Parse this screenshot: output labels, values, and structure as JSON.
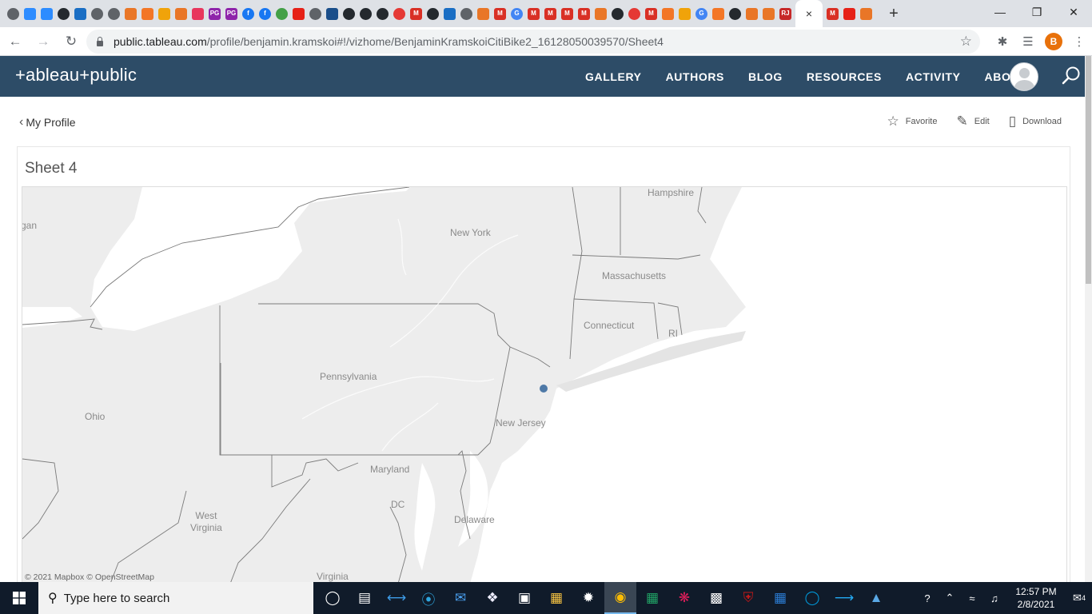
{
  "browser": {
    "tab_close_glyph": "×",
    "new_tab_glyph": "+",
    "tab_favicons": [
      {
        "name": "globe-icon",
        "color": "#5f6368",
        "glyph": "",
        "round": true
      },
      {
        "name": "zoom-icon",
        "color": "#2d8cff",
        "glyph": "",
        "round": false
      },
      {
        "name": "zoom-icon",
        "color": "#2d8cff",
        "glyph": "",
        "round": false
      },
      {
        "name": "github-icon",
        "color": "#24292e",
        "glyph": "",
        "round": true
      },
      {
        "name": "citibike-icon",
        "color": "#1a6ec4",
        "glyph": "",
        "round": false
      },
      {
        "name": "globe-icon",
        "color": "#5f6368",
        "glyph": "",
        "round": true
      },
      {
        "name": "globe-icon",
        "color": "#5f6368",
        "glyph": "",
        "round": true
      },
      {
        "name": "tableau-icon",
        "color": "#e97627",
        "glyph": "",
        "round": false
      },
      {
        "name": "jupyter-icon",
        "color": "#f37626",
        "glyph": "",
        "round": false
      },
      {
        "name": "notebook-icon",
        "color": "#f0a30a",
        "glyph": "",
        "round": false
      },
      {
        "name": "tableau-icon",
        "color": "#e97627",
        "glyph": "",
        "round": false
      },
      {
        "name": "stack-icon",
        "color": "#e8365d",
        "glyph": "",
        "round": false
      },
      {
        "name": "pg-icon",
        "color": "#8e24aa",
        "glyph": "PG",
        "round": false
      },
      {
        "name": "pg-icon",
        "color": "#8e24aa",
        "glyph": "PG",
        "round": false
      },
      {
        "name": "facebook-icon",
        "color": "#1877f2",
        "glyph": "f",
        "round": true
      },
      {
        "name": "facebook-icon",
        "color": "#1877f2",
        "glyph": "f",
        "round": true
      },
      {
        "name": "spiral-icon",
        "color": "#43a047",
        "glyph": "",
        "round": true
      },
      {
        "name": "youtube-icon",
        "color": "#e62117",
        "glyph": "",
        "round": false
      },
      {
        "name": "globe-icon",
        "color": "#5f6368",
        "glyph": "",
        "round": true
      },
      {
        "name": "atp-icon",
        "color": "#1a4e8a",
        "glyph": "",
        "round": false
      },
      {
        "name": "github-icon",
        "color": "#24292e",
        "glyph": "",
        "round": true
      },
      {
        "name": "github-icon",
        "color": "#24292e",
        "glyph": "",
        "round": true
      },
      {
        "name": "github-icon",
        "color": "#24292e",
        "glyph": "",
        "round": true
      },
      {
        "name": "lifebuoy-icon",
        "color": "#e53935",
        "glyph": "",
        "round": true
      },
      {
        "name": "gmail-icon",
        "color": "#d93025",
        "glyph": "M",
        "round": false
      },
      {
        "name": "github-icon",
        "color": "#24292e",
        "glyph": "",
        "round": true
      },
      {
        "name": "citibike-icon",
        "color": "#1a6ec4",
        "glyph": "",
        "round": false
      },
      {
        "name": "globe-icon",
        "color": "#5f6368",
        "glyph": "",
        "round": true
      },
      {
        "name": "tableau-icon",
        "color": "#e97627",
        "glyph": "",
        "round": false
      },
      {
        "name": "gmail-icon",
        "color": "#d93025",
        "glyph": "M",
        "round": false
      },
      {
        "name": "google-icon",
        "color": "#4285f4",
        "glyph": "G",
        "round": true
      },
      {
        "name": "gmail-icon",
        "color": "#d93025",
        "glyph": "M",
        "round": false
      },
      {
        "name": "gmail-icon",
        "color": "#d93025",
        "glyph": "M",
        "round": false
      },
      {
        "name": "gmail-icon",
        "color": "#d93025",
        "glyph": "M",
        "round": false
      },
      {
        "name": "gmail-icon",
        "color": "#d93025",
        "glyph": "M",
        "round": false
      },
      {
        "name": "tableau-icon",
        "color": "#e97627",
        "glyph": "",
        "round": false
      },
      {
        "name": "github-icon",
        "color": "#24292e",
        "glyph": "",
        "round": true
      },
      {
        "name": "lifebuoy-icon",
        "color": "#e53935",
        "glyph": "",
        "round": true
      },
      {
        "name": "gmail-icon",
        "color": "#d93025",
        "glyph": "M",
        "round": false
      },
      {
        "name": "jupyter-icon",
        "color": "#f37626",
        "glyph": "",
        "round": false
      },
      {
        "name": "notebook-icon",
        "color": "#f0a30a",
        "glyph": "",
        "round": false
      },
      {
        "name": "google-icon",
        "color": "#4285f4",
        "glyph": "G",
        "round": true
      },
      {
        "name": "jupyter-icon",
        "color": "#f37626",
        "glyph": "",
        "round": false
      },
      {
        "name": "github-icon",
        "color": "#24292e",
        "glyph": "",
        "round": true
      },
      {
        "name": "tableau-icon",
        "color": "#e97627",
        "glyph": "",
        "round": false
      },
      {
        "name": "tableau-icon",
        "color": "#e97627",
        "glyph": "",
        "round": false
      },
      {
        "name": "rj-icon",
        "color": "#c62828",
        "glyph": "RJ",
        "round": false
      }
    ],
    "tab_favicons_after": [
      {
        "name": "gmail-icon",
        "color": "#d93025",
        "glyph": "M",
        "round": false
      },
      {
        "name": "youtube-icon",
        "color": "#e62117",
        "glyph": "",
        "round": false
      },
      {
        "name": "tableau-icon",
        "color": "#e97627",
        "glyph": "",
        "round": false
      }
    ],
    "window_controls": {
      "minimize": "—",
      "restore": "❐",
      "close": "✕"
    },
    "url_host": "public.tableau.com",
    "url_path": "/profile/benjamin.kramskoi#!/vizhome/BenjaminKramskoiCitiBike2_16128050039570/Sheet4",
    "profile_initial": "B"
  },
  "site": {
    "logo_text": "+ableau+public",
    "nav": [
      "GALLERY",
      "AUTHORS",
      "BLOG",
      "RESOURCES",
      "ACTIVITY",
      "ABOUT"
    ],
    "brand_color": "#2d4c67"
  },
  "page": {
    "back_label": "My Profile",
    "actions": {
      "favorite": "Favorite",
      "edit": "Edit",
      "download": "Download"
    },
    "sheet_title": "Sheet 4"
  },
  "map": {
    "labels": [
      {
        "text": "Hampshire",
        "key": "hampshire"
      },
      {
        "text": "New York",
        "key": "new-york"
      },
      {
        "text": "Massachusetts",
        "key": "massachusetts"
      },
      {
        "text": "Connecticut",
        "key": "connecticut"
      },
      {
        "text": "RI",
        "key": "ri"
      },
      {
        "text": "gan",
        "key": "michigan"
      },
      {
        "text": "Pennsylvania",
        "key": "pennsylvania"
      },
      {
        "text": "Ohio",
        "key": "ohio"
      },
      {
        "text": "New Jersey",
        "key": "new-jersey"
      },
      {
        "text": "Maryland",
        "key": "maryland"
      },
      {
        "text": "DC",
        "key": "dc"
      },
      {
        "text": "West\nVirginia",
        "key": "west-virginia"
      },
      {
        "text": "Delaware",
        "key": "delaware"
      },
      {
        "text": "Virginia",
        "key": "virginia"
      }
    ],
    "attribution": "© 2021 Mapbox  © OpenStreetMap",
    "point_color": "#4e79a7",
    "land_color": "#ededed",
    "water_color": "#ffffff"
  },
  "taskbar": {
    "search_placeholder": "Type here to search",
    "time": "12:57 PM",
    "date": "2/8/2021",
    "notification_count": "4"
  }
}
